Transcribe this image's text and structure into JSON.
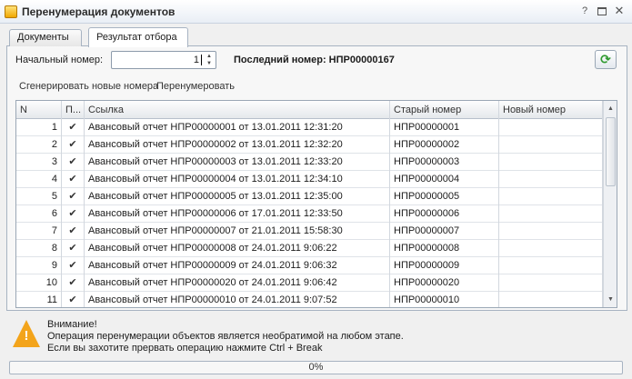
{
  "window": {
    "title": "Перенумерация документов"
  },
  "tabs": [
    {
      "label": "Документы"
    },
    {
      "label": "Результат отбора"
    }
  ],
  "form": {
    "start_label": "Начальный номер:",
    "start_value": "1",
    "last_number": "Последний номер: НПР00000167"
  },
  "commands": {
    "generate": "Сгенерировать новые номера",
    "renumber": "Перенумеровать"
  },
  "table": {
    "columns": [
      "N",
      "П...",
      "Ссылка",
      "Старый номер",
      "Новый номер"
    ],
    "rows": [
      {
        "n": "1",
        "p": "✔",
        "ref": "Авансовый отчет НПР00000001 от 13.01.2011 12:31:20",
        "old": "НПР00000001",
        "new": ""
      },
      {
        "n": "2",
        "p": "✔",
        "ref": "Авансовый отчет НПР00000002 от 13.01.2011 12:32:20",
        "old": "НПР00000002",
        "new": ""
      },
      {
        "n": "3",
        "p": "✔",
        "ref": "Авансовый отчет НПР00000003 от 13.01.2011 12:33:20",
        "old": "НПР00000003",
        "new": ""
      },
      {
        "n": "4",
        "p": "✔",
        "ref": "Авансовый отчет НПР00000004 от 13.01.2011 12:34:10",
        "old": "НПР00000004",
        "new": ""
      },
      {
        "n": "5",
        "p": "✔",
        "ref": "Авансовый отчет НПР00000005 от 13.01.2011 12:35:00",
        "old": "НПР00000005",
        "new": ""
      },
      {
        "n": "6",
        "p": "✔",
        "ref": "Авансовый отчет НПР00000006 от 17.01.2011 12:33:50",
        "old": "НПР00000006",
        "new": ""
      },
      {
        "n": "7",
        "p": "✔",
        "ref": "Авансовый отчет НПР00000007 от 21.01.2011 15:58:30",
        "old": "НПР00000007",
        "new": ""
      },
      {
        "n": "8",
        "p": "✔",
        "ref": "Авансовый отчет НПР00000008 от 24.01.2011 9:06:22",
        "old": "НПР00000008",
        "new": ""
      },
      {
        "n": "9",
        "p": "✔",
        "ref": "Авансовый отчет НПР00000009 от 24.01.2011 9:06:32",
        "old": "НПР00000009",
        "new": ""
      },
      {
        "n": "10",
        "p": "✔",
        "ref": "Авансовый отчет НПР00000020 от 24.01.2011 9:06:42",
        "old": "НПР00000020",
        "new": ""
      },
      {
        "n": "11",
        "p": "✔",
        "ref": "Авансовый отчет НПР00000010 от 24.01.2011 9:07:52",
        "old": "НПР00000010",
        "new": ""
      }
    ]
  },
  "warning": {
    "title": "Внимание!",
    "line1": "Операция перенумерации объектов является необратимой на любом этапе.",
    "line2": "Если вы захотите прервать операцию нажмите Ctrl + Break"
  },
  "progress": {
    "percent": 0,
    "label": "0%"
  },
  "colors": {
    "accent": "#f3a41b",
    "refresh": "#2f9a2f"
  }
}
